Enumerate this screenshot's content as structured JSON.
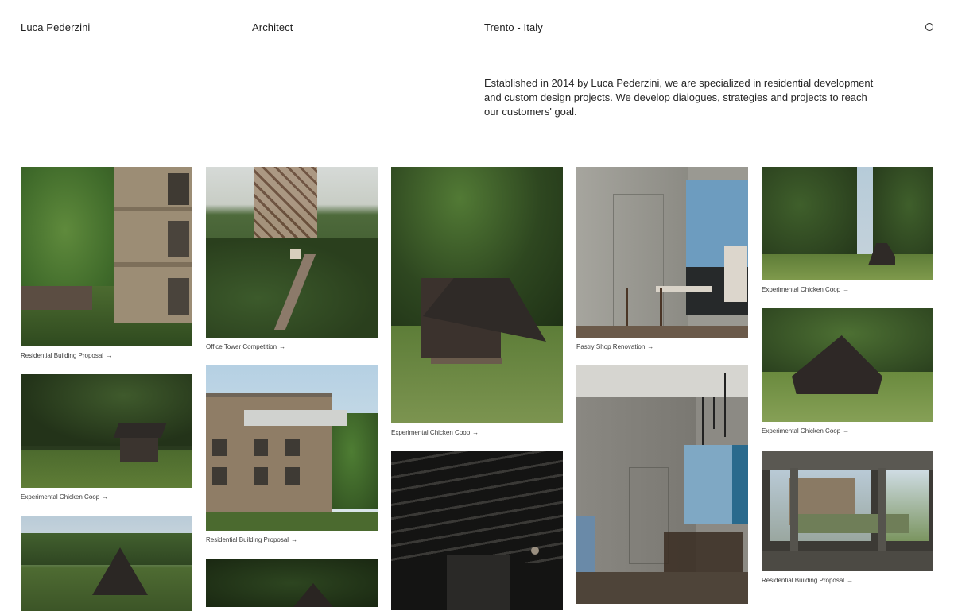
{
  "header": {
    "name": "Luca Pederzini",
    "role": "Architect",
    "location": "Trento - Italy"
  },
  "intro": {
    "text": "Established in 2014 by Luca Pederzini, we are specialized in residential development and custom design projects. We develop dialogues, strategies and projects to reach our customers' goal."
  },
  "arrow": "→",
  "projects": [
    {
      "caption": "Residential Building Proposal"
    },
    {
      "caption": "Experimental Chicken Coop"
    },
    {
      "caption": "Office Tower Competition"
    },
    {
      "caption": "Residential Building Proposal"
    },
    {
      "caption": "Experimental Chicken Coop"
    },
    {
      "caption": "Pastry Shop Renovation"
    },
    {
      "caption": "Experimental Chicken Coop"
    },
    {
      "caption": "Experimental Chicken Coop"
    },
    {
      "caption": "Residential Building Proposal"
    }
  ],
  "colors": {
    "foliage_dark": "#2e3d24",
    "foliage": "#4d6a35",
    "grass": "#6d8a40",
    "sky": "#cfd9e0",
    "wood_dark": "#3b3733",
    "concrete": "#8e8f88",
    "interior_dark": "#1b1b1a",
    "accent_blue": "#6d9cbf"
  }
}
